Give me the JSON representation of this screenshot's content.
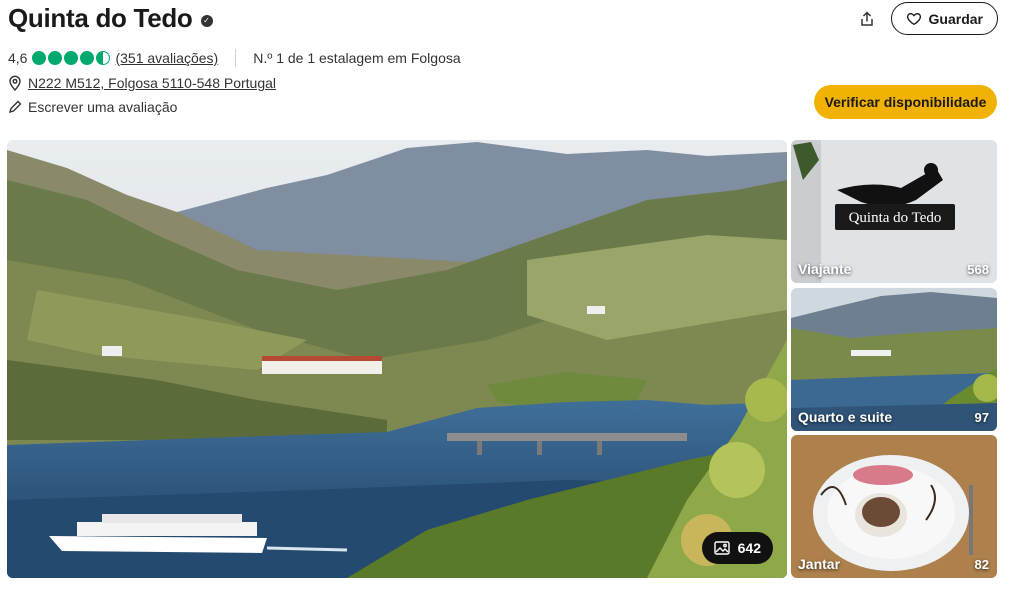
{
  "header": {
    "title": "Quinta do Tedo",
    "save_label": "Guardar"
  },
  "rating": {
    "score": "4,6",
    "bubbles_value": 4.5,
    "bubbles_max": 5,
    "reviews_link": "(351 avaliações)",
    "ranking": "N.º 1 de 1 estalagem em Folgosa"
  },
  "address": "N222 M512, Folgosa 5110-548 Portugal",
  "write_review": "Escrever uma avaliação",
  "check_button": "Verificar disponibilidade",
  "gallery": {
    "main_photo_count": "642",
    "thumbs": [
      {
        "label": "Viajante",
        "count": "568",
        "sign_text": "Quinta do Tedo"
      },
      {
        "label": "Quarto e suite",
        "count": "97"
      },
      {
        "label": "Jantar",
        "count": "82"
      }
    ]
  },
  "colors": {
    "accent_yellow": "#f2b203",
    "rating_green": "#00aa6c",
    "text_dark": "#1a1a1a"
  },
  "icons": [
    "verified-icon",
    "share-icon",
    "heart-icon",
    "location-pin-icon",
    "pencil-icon",
    "image-icon"
  ]
}
